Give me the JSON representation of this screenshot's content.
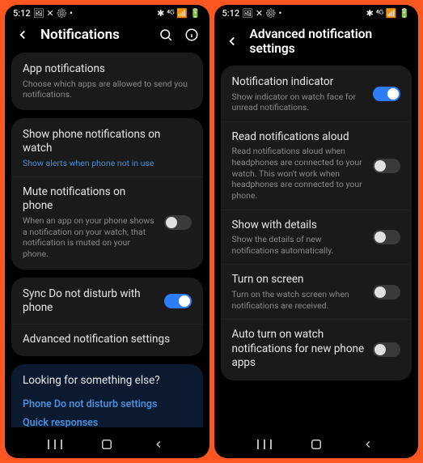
{
  "status": {
    "time": "5:12",
    "icons_left": "🖼 ✕ ⚙ •",
    "icons_right": "✱ ⁴ᴳ 📶 🔋"
  },
  "left": {
    "title": "Notifications",
    "card1": {
      "app_notif_title": "App notifications",
      "app_notif_sub": "Choose which apps are allowed to send you notifications."
    },
    "card2": {
      "show_title": "Show phone notifications on watch",
      "show_sub": "Show alerts when phone not in use",
      "mute_title": "Mute notifications on phone",
      "mute_sub": "When an app on your phone shows a notification on your watch, that notification is muted on your phone."
    },
    "card3": {
      "sync_title": "Sync Do not disturb with phone",
      "adv_title": "Advanced notification settings"
    },
    "looking": {
      "title": "Looking for something else?",
      "link1": "Phone Do not disturb settings",
      "link2": "Quick responses"
    }
  },
  "right": {
    "title": "Advanced notification settings",
    "rows": {
      "indicator_title": "Notification indicator",
      "indicator_sub": "Show indicator on watch face for unread notifications.",
      "read_title": "Read notifications aloud",
      "read_sub": "Read notifications aloud when headphones are connected to your watch. This won't work when headphones are connected to your phone.",
      "details_title": "Show with details",
      "details_sub": "Show the details of new notifications automatically.",
      "screen_title": "Turn on screen",
      "screen_sub": "Turn on the watch screen when notifications are received.",
      "auto_title": "Auto turn on watch notifications for new phone apps"
    }
  }
}
